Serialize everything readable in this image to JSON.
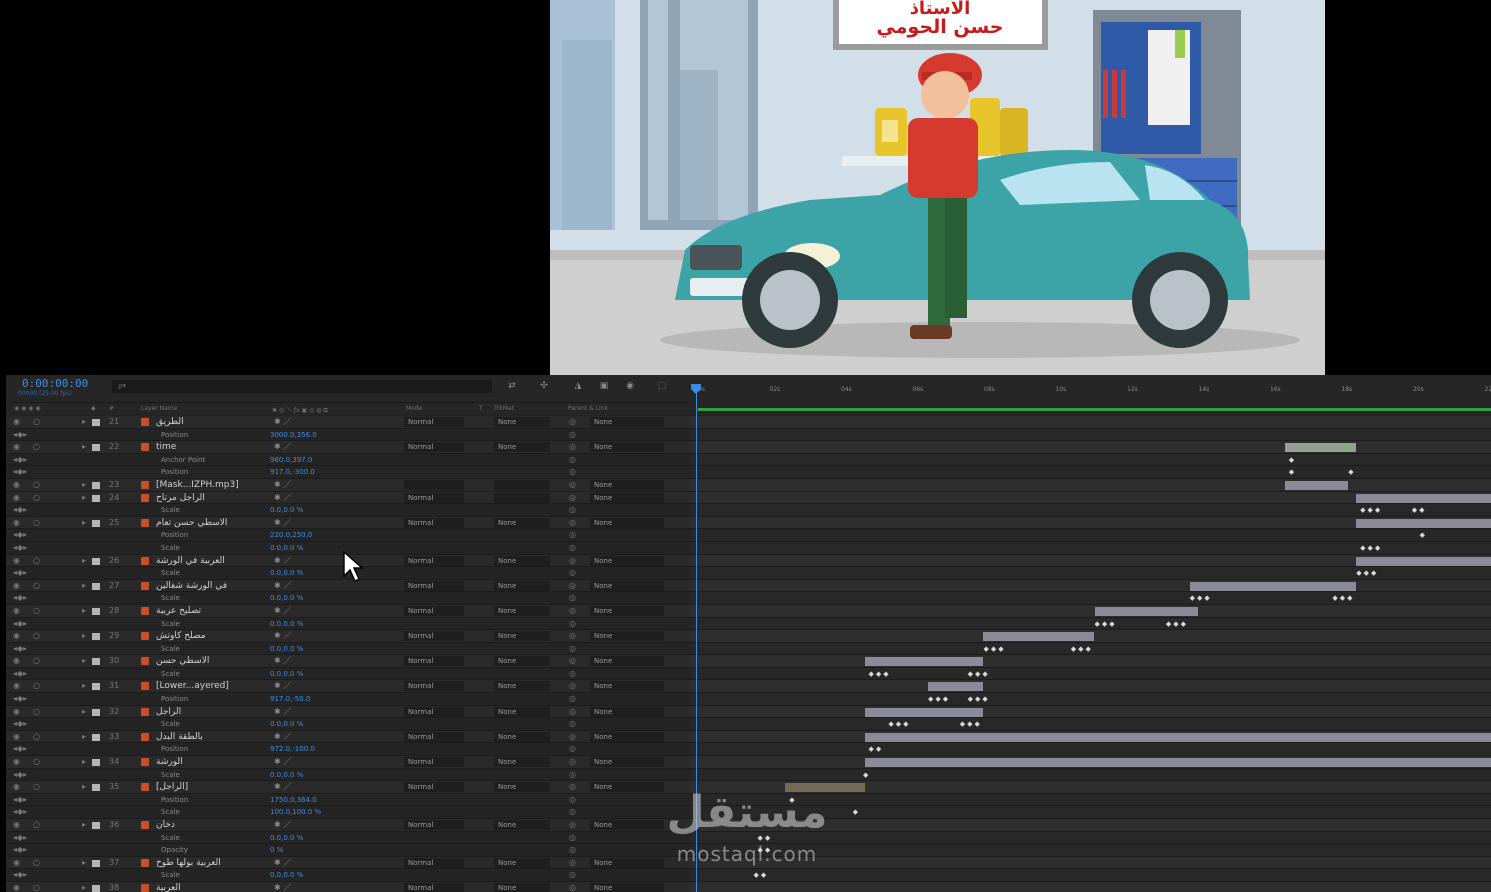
{
  "preview": {
    "sign_line1": "الاستاذ",
    "sign_line2": "حسن الحومي"
  },
  "timeline": {
    "timecode": "0:00:00:00",
    "fps": "00000 (25.00 fps)",
    "search_placeholder": "ρ▾",
    "columns": {
      "layer_name": "Layer Name",
      "mode": "Mode",
      "t": "T",
      "trkmat": "TrkMat",
      "parent": "Parent & Link"
    },
    "ruler_ticks": [
      "0s",
      "02s",
      "04s",
      "06s",
      "08s",
      "10s",
      "12s",
      "14s",
      "16s",
      "18s",
      "20s",
      "22"
    ],
    "rows": [
      {
        "kind": "layer",
        "num": "21",
        "name": "الطريق",
        "mode": "Normal",
        "trk": "None",
        "parent": "None"
      },
      {
        "kind": "prop",
        "name": "Position",
        "value": "3000.0,356.0"
      },
      {
        "kind": "layer",
        "num": "22",
        "name": "time",
        "mode": "Normal",
        "trk": "None",
        "parent": "None"
      },
      {
        "kind": "prop",
        "name": "Anchor Point",
        "value": "960.0,397.0"
      },
      {
        "kind": "prop",
        "name": "Position",
        "value": "917.0,-300.0"
      },
      {
        "kind": "layer",
        "num": "23",
        "name": "[Mask...IZPH.mp3]",
        "mode": "",
        "trk": "",
        "parent": "None"
      },
      {
        "kind": "layer",
        "num": "24",
        "name": "الراجل مرتاح",
        "mode": "Normal",
        "trk": "",
        "parent": "None"
      },
      {
        "kind": "prop",
        "name": "Scale",
        "value": "0.0,0.0 %"
      },
      {
        "kind": "layer",
        "num": "25",
        "name": "الاسطي حسن تعام",
        "mode": "Normal",
        "trk": "None",
        "parent": "None"
      },
      {
        "kind": "prop",
        "name": "Position",
        "value": "220.0,250.0"
      },
      {
        "kind": "prop",
        "name": "Scale",
        "value": "0.0,0.0 %"
      },
      {
        "kind": "layer",
        "num": "26",
        "name": "العربية في الورشة",
        "mode": "Normal",
        "trk": "None",
        "parent": "None"
      },
      {
        "kind": "prop",
        "name": "Scale",
        "value": "0.0,0.0 %"
      },
      {
        "kind": "layer",
        "num": "27",
        "name": "في الورشة شغالين",
        "mode": "Normal",
        "trk": "None",
        "parent": "None"
      },
      {
        "kind": "prop",
        "name": "Scale",
        "value": "0.0,0.0 %"
      },
      {
        "kind": "layer",
        "num": "28",
        "name": "تصليح عربية",
        "mode": "Normal",
        "trk": "None",
        "parent": "None"
      },
      {
        "kind": "prop",
        "name": "Scale",
        "value": "0.0,0.0 %"
      },
      {
        "kind": "layer",
        "num": "29",
        "name": "مصلح كاوتش",
        "mode": "Normal",
        "trk": "None",
        "parent": "None"
      },
      {
        "kind": "prop",
        "name": "Scale",
        "value": "0.0,0.0 %"
      },
      {
        "kind": "layer",
        "num": "30",
        "name": "الاسطي حسن",
        "mode": "Normal",
        "trk": "None",
        "parent": "None"
      },
      {
        "kind": "prop",
        "name": "Scale",
        "value": "0.0,0.0 %"
      },
      {
        "kind": "layer",
        "num": "31",
        "name": "[Lower...ayered]",
        "mode": "Normal",
        "trk": "None",
        "parent": "None"
      },
      {
        "kind": "prop",
        "name": "Position",
        "value": "917.0,-50.0"
      },
      {
        "kind": "layer",
        "num": "32",
        "name": "الراجل",
        "mode": "Normal",
        "trk": "None",
        "parent": "None"
      },
      {
        "kind": "prop",
        "name": "Scale",
        "value": "0.0,0.0 %"
      },
      {
        "kind": "layer",
        "num": "33",
        "name": "بالطقة البدل",
        "mode": "Normal",
        "trk": "None",
        "parent": "None"
      },
      {
        "kind": "prop",
        "name": "Position",
        "value": "972.0,-100.0"
      },
      {
        "kind": "layer",
        "num": "34",
        "name": "الورشة",
        "mode": "Normal",
        "trk": "None",
        "parent": "None"
      },
      {
        "kind": "prop",
        "name": "Scale",
        "value": "0.0,0.0 %"
      },
      {
        "kind": "layer",
        "num": "35",
        "name": "[الراجل]",
        "mode": "Normal",
        "trk": "None",
        "parent": "None"
      },
      {
        "kind": "prop",
        "name": "Position",
        "value": "1750.0,364.0"
      },
      {
        "kind": "prop",
        "name": "Scale",
        "value": "100.0,100.0 %"
      },
      {
        "kind": "layer",
        "num": "36",
        "name": "دخان",
        "mode": "Normal",
        "trk": "None",
        "parent": "None"
      },
      {
        "kind": "prop",
        "name": "Scale",
        "value": "0.0,0.0 %"
      },
      {
        "kind": "prop",
        "name": "Opacity",
        "value": "0 %"
      },
      {
        "kind": "layer",
        "num": "37",
        "name": "العربية بولها طوخ",
        "mode": "Normal",
        "trk": "None",
        "parent": "None"
      },
      {
        "kind": "prop",
        "name": "Scale",
        "value": "0.0,0.0 %"
      },
      {
        "kind": "layer",
        "num": "38",
        "name": "العربية",
        "mode": "Normal",
        "trk": "None",
        "parent": "None"
      }
    ]
  },
  "track_bars": [
    {
      "row": 2,
      "start": 0.74,
      "end": 0.83,
      "style": "green"
    },
    {
      "row": 5,
      "start": 0.74,
      "end": 0.82,
      "style": "gray"
    },
    {
      "row": 6,
      "start": 0.83,
      "end": 1.0,
      "style": "gray"
    },
    {
      "row": 8,
      "start": 0.83,
      "end": 1.0,
      "style": "gray"
    },
    {
      "row": 11,
      "start": 0.83,
      "end": 1.0,
      "style": "gray"
    },
    {
      "row": 13,
      "start": 0.62,
      "end": 0.83,
      "style": "gray"
    },
    {
      "row": 15,
      "start": 0.5,
      "end": 0.63,
      "style": "gray"
    },
    {
      "row": 17,
      "start": 0.36,
      "end": 0.5,
      "style": "gray"
    },
    {
      "row": 19,
      "start": 0.21,
      "end": 0.36,
      "style": "gray"
    },
    {
      "row": 21,
      "start": 0.29,
      "end": 0.36,
      "style": "gray"
    },
    {
      "row": 23,
      "start": 0.21,
      "end": 0.36,
      "style": "gray"
    },
    {
      "row": 25,
      "start": 0.21,
      "end": 1.0,
      "style": "gray"
    },
    {
      "row": 27,
      "start": 0.21,
      "end": 1.0,
      "style": "gray"
    },
    {
      "row": 29,
      "start": 0.11,
      "end": 0.21,
      "style": "tan"
    },
    {
      "row": 38,
      "start": 0.0,
      "end": 0.07,
      "style": "gray"
    }
  ],
  "keyframes": [
    {
      "row": 3,
      "pos": 0.745,
      "text": "◆"
    },
    {
      "row": 4,
      "pos": 0.745,
      "text": "◆"
    },
    {
      "row": 4,
      "pos": 0.82,
      "text": "◆"
    },
    {
      "row": 7,
      "pos": 0.835,
      "text": "◆◆◆"
    },
    {
      "row": 7,
      "pos": 0.9,
      "text": "◆◆"
    },
    {
      "row": 9,
      "pos": 0.91,
      "text": "◆"
    },
    {
      "row": 10,
      "pos": 0.835,
      "text": "◆◆◆"
    },
    {
      "row": 12,
      "pos": 0.83,
      "text": "◆◆◆"
    },
    {
      "row": 14,
      "pos": 0.62,
      "text": "◆◆◆"
    },
    {
      "row": 14,
      "pos": 0.8,
      "text": "◆◆◆"
    },
    {
      "row": 16,
      "pos": 0.5,
      "text": "◆◆◆"
    },
    {
      "row": 16,
      "pos": 0.59,
      "text": "◆◆◆"
    },
    {
      "row": 18,
      "pos": 0.36,
      "text": "◆◆◆"
    },
    {
      "row": 18,
      "pos": 0.47,
      "text": "◆◆◆"
    },
    {
      "row": 20,
      "pos": 0.215,
      "text": "◆◆◆"
    },
    {
      "row": 20,
      "pos": 0.34,
      "text": "◆◆◆"
    },
    {
      "row": 22,
      "pos": 0.29,
      "text": "◆◆◆"
    },
    {
      "row": 22,
      "pos": 0.34,
      "text": "◆◆◆"
    },
    {
      "row": 24,
      "pos": 0.24,
      "text": "◆◆◆"
    },
    {
      "row": 24,
      "pos": 0.33,
      "text": "◆◆◆"
    },
    {
      "row": 26,
      "pos": 0.215,
      "text": "◆◆"
    },
    {
      "row": 28,
      "pos": 0.208,
      "text": "◆"
    },
    {
      "row": 30,
      "pos": 0.115,
      "text": "◆"
    },
    {
      "row": 31,
      "pos": 0.195,
      "text": "◆"
    },
    {
      "row": 33,
      "pos": 0.075,
      "text": "◆◆"
    },
    {
      "row": 34,
      "pos": 0.075,
      "text": "◆◆"
    },
    {
      "row": 36,
      "pos": 0.07,
      "text": "◆◆"
    }
  ],
  "watermark": {
    "logo": "مستقل",
    "url": "mostaql.com"
  }
}
